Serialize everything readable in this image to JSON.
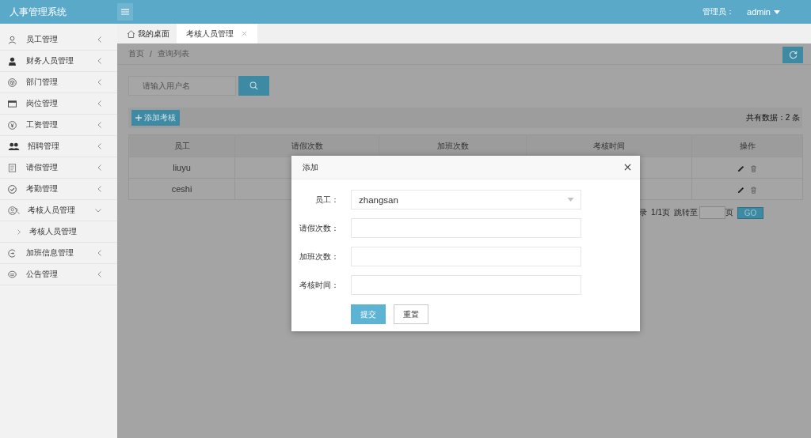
{
  "header": {
    "title": "人事管理系统",
    "user_label": "管理员：",
    "user_name": "admin"
  },
  "sidebar": {
    "items": [
      {
        "label": "员工管理",
        "expanded": false
      },
      {
        "label": "财务人员管理",
        "expanded": false
      },
      {
        "label": "部门管理",
        "expanded": false
      },
      {
        "label": "岗位管理",
        "expanded": false
      },
      {
        "label": "工资管理",
        "expanded": false
      },
      {
        "label": "招聘管理",
        "expanded": false
      },
      {
        "label": "请假管理",
        "expanded": false
      },
      {
        "label": "考勤管理",
        "expanded": false
      },
      {
        "label": "考核人员管理",
        "expanded": true,
        "children": [
          {
            "label": "考核人员管理"
          }
        ]
      },
      {
        "label": "加班信息管理",
        "expanded": false
      },
      {
        "label": "公告管理",
        "expanded": false
      }
    ]
  },
  "tabs": [
    {
      "label": "我的桌面",
      "selected": false,
      "closable": false
    },
    {
      "label": "考核人员管理",
      "selected": true,
      "closable": true
    }
  ],
  "breadcrumb": {
    "items": [
      "首页",
      "查询列表"
    ],
    "separator": "/"
  },
  "search": {
    "placeholder": "请输入用户名"
  },
  "toolbar": {
    "add_button": "添加考核",
    "total": "共有数据：2 条"
  },
  "table": {
    "columns": [
      "员工",
      "请假次数",
      "加班次数",
      "考核时间",
      "操作"
    ],
    "rows": [
      {
        "employee": "liuyu"
      },
      {
        "employee": "ceshi"
      }
    ]
  },
  "pagination": {
    "summary_tail": "录",
    "page": "1/1页",
    "jump_label": "跳转至",
    "page_suffix": "页",
    "go_button": "GO"
  },
  "modal": {
    "title": "添加",
    "fields": [
      {
        "label": "员工：",
        "kind": "select",
        "value": "zhangsan"
      },
      {
        "label": "请假次数：",
        "kind": "text"
      },
      {
        "label": "加班次数：",
        "kind": "text"
      },
      {
        "label": "考核时间：",
        "kind": "text"
      }
    ],
    "buttons": [
      {
        "label": "提交",
        "kind": "primary"
      },
      {
        "label": "重置",
        "kind": "default"
      }
    ]
  }
}
